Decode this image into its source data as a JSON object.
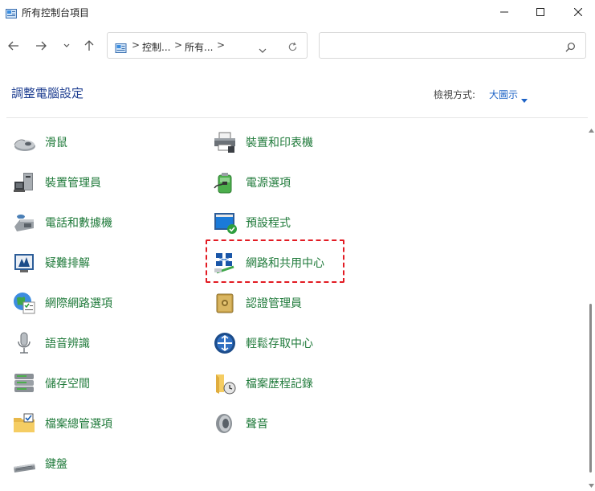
{
  "window": {
    "title": "所有控制台項目"
  },
  "address": {
    "crumbs": [
      "控制...",
      "所有..."
    ],
    "separator": ">"
  },
  "search": {
    "placeholder": ""
  },
  "header": {
    "title": "調整電腦設定",
    "view_by_label": "檢視方式:",
    "view_by_value": "大圖示"
  },
  "items_left": [
    {
      "label": "滑鼠",
      "icon": "mouse-icon"
    },
    {
      "label": "裝置管理員",
      "icon": "device-manager-icon"
    },
    {
      "label": "電話和數據機",
      "icon": "phone-modem-icon"
    },
    {
      "label": "疑難排解",
      "icon": "troubleshooting-icon"
    },
    {
      "label": "網際網路選項",
      "icon": "internet-options-icon"
    },
    {
      "label": "語音辨識",
      "icon": "microphone-icon"
    },
    {
      "label": "儲存空間",
      "icon": "storage-spaces-icon"
    },
    {
      "label": "檔案總管選項",
      "icon": "folder-options-icon"
    },
    {
      "label": "鍵盤",
      "icon": "keyboard-icon"
    }
  ],
  "items_right": [
    {
      "label": "裝置和印表機",
      "icon": "printer-icon"
    },
    {
      "label": "電源選項",
      "icon": "power-options-icon"
    },
    {
      "label": "預設程式",
      "icon": "default-programs-icon"
    },
    {
      "label": "網路和共用中心",
      "icon": "network-sharing-icon"
    },
    {
      "label": "認證管理員",
      "icon": "credential-manager-icon"
    },
    {
      "label": "輕鬆存取中心",
      "icon": "ease-of-access-icon"
    },
    {
      "label": "檔案歷程記錄",
      "icon": "file-history-icon"
    },
    {
      "label": "聲音",
      "icon": "speaker-icon"
    }
  ],
  "colors": {
    "item_label": "#1f7a3a",
    "title": "#1f3f91",
    "highlight": "#e21b23",
    "link": "#1e63c6"
  }
}
